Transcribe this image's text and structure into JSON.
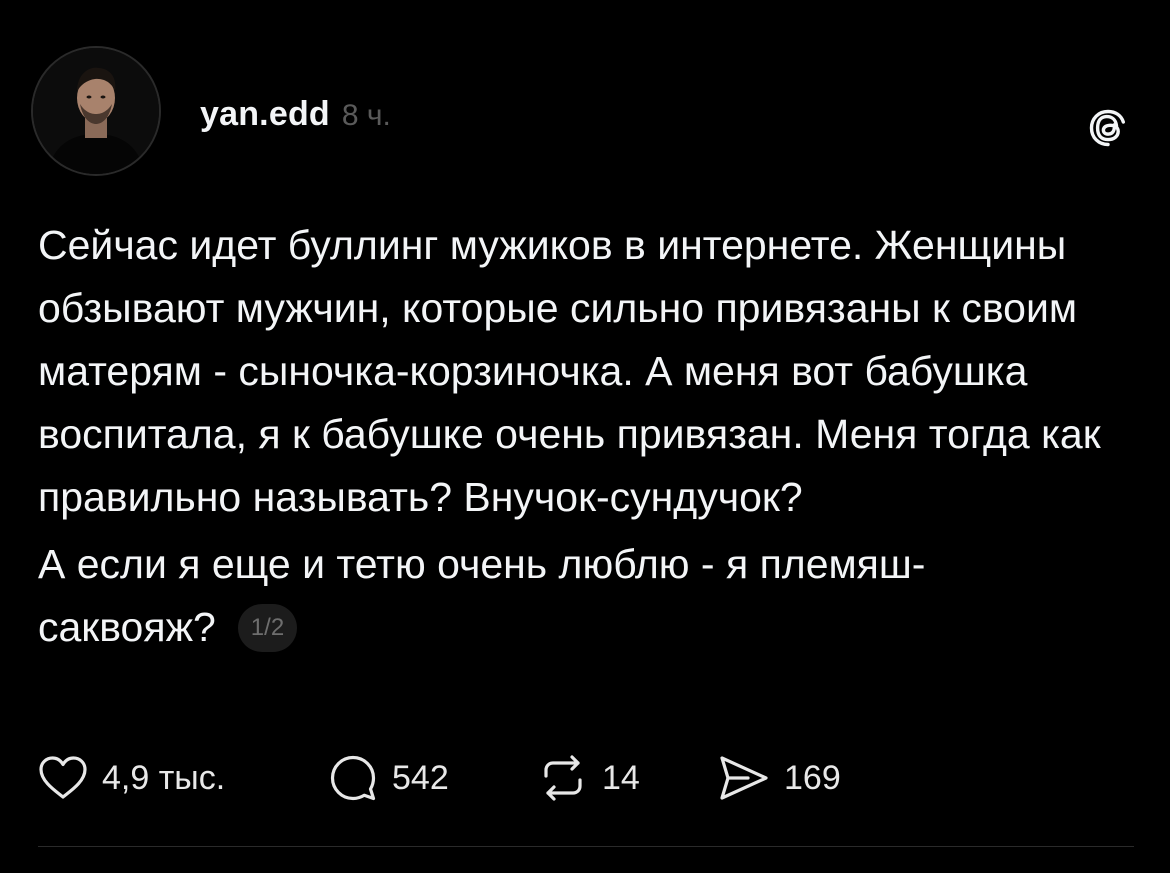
{
  "post": {
    "username": "yan.edd",
    "time": "8 ч.",
    "paragraph1": "Сейчас идет буллинг мужиков в интернете. Женщины обзывают мужчин, которые сильно привязаны к своим матерям - сыночка-корзиночка. А меня вот бабушка воспитала, я к бабушке очень привязан. Меня тогда как правильно называть? Внучок-сундучок?",
    "paragraph2_line1": "А если я еще и тетю очень люблю - я племяш-",
    "paragraph2_line2": "саквояж?",
    "page_indicator": "1/2"
  },
  "actions": {
    "likes": "4,9 тыс.",
    "comments": "542",
    "reposts": "14",
    "shares": "169"
  },
  "icons": {
    "like": "heart-icon",
    "comment": "comment-bubble-icon",
    "repost": "repost-icon",
    "share": "send-icon",
    "app": "threads-logo-icon"
  },
  "colors": {
    "background": "#000000",
    "text": "#f3f5f7",
    "muted": "#5a5a5a"
  }
}
